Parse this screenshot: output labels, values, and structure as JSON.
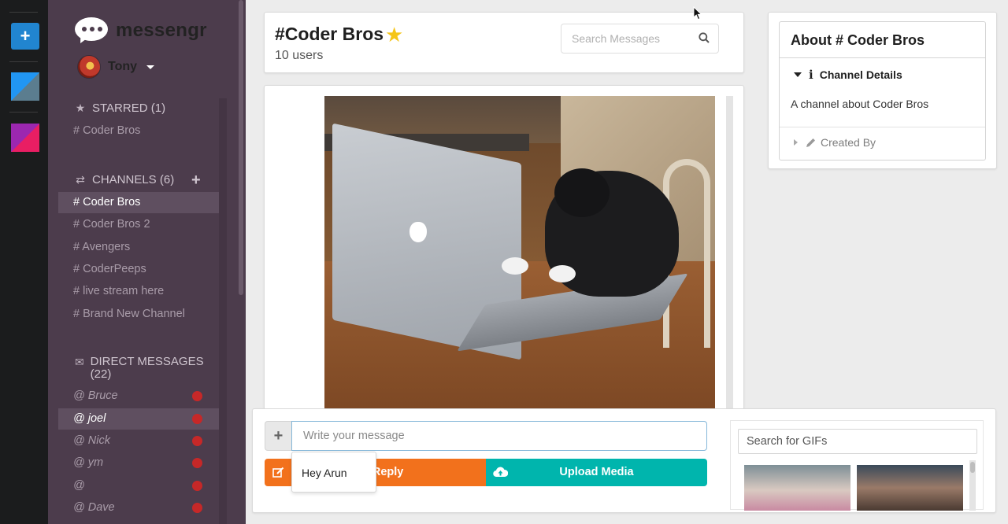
{
  "app": {
    "brand_name": "messengr",
    "user_name": "Tony"
  },
  "sidebar": {
    "starred": {
      "title": "STARRED (1)",
      "items": [
        "# Coder Bros"
      ]
    },
    "channels": {
      "title": "CHANNELS (6)",
      "items": [
        "# Coder Bros",
        "# Coder Bros 2",
        "# Avengers",
        "# CoderPeeps",
        "# live stream here",
        "# Brand New Channel"
      ],
      "active_index": 0
    },
    "direct_messages": {
      "title": "DIRECT MESSAGES (22)",
      "items": [
        "@ Bruce",
        "@ joel",
        "@ Nick",
        "@ ym",
        "@",
        "@ Dave"
      ],
      "active_index": 1
    }
  },
  "header": {
    "channel_title": "#Coder Bros",
    "user_count": "10 users",
    "search_placeholder": "Search Messages"
  },
  "compose": {
    "message_placeholder": "Write your message",
    "reply_label": "Add Reply",
    "upload_label": "Upload Media",
    "suggestion": "Hey Arun",
    "gif_search_placeholder": "Search for GIFs"
  },
  "about": {
    "title": "About # Coder Bros",
    "details_label": "Channel Details",
    "details_text": "A channel about Coder Bros",
    "created_by_label": "Created By"
  },
  "colors": {
    "sidebar_bg": "#4c3c4c",
    "reply_button": "#f2711c",
    "upload_button": "#00b5ad",
    "rail_add": "#2185d0",
    "star": "#f5c518",
    "unread_dot": "#c62828"
  },
  "icons": {
    "rail_add": "plus-icon",
    "starred": "star-icon",
    "channels": "exchange-icon",
    "direct_messages": "mail-icon",
    "search": "search-icon",
    "reply": "edit-icon",
    "upload": "cloud-upload-icon",
    "details": "info-icon",
    "created_by": "pencil-icon"
  }
}
